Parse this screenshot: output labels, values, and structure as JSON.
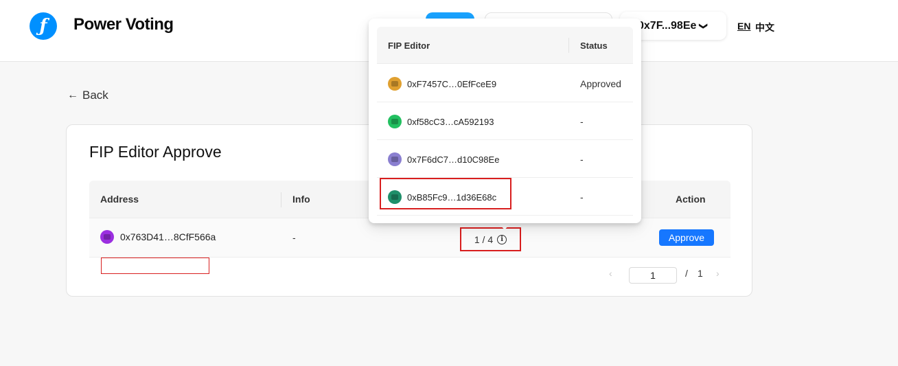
{
  "header": {
    "app_title": "Power Voting",
    "logo_glyph": "ƒ",
    "wallet_address": "0x7F...98Ee",
    "wallet_chevron": "❯",
    "lang_en": "EN",
    "lang_zh": "中文"
  },
  "nav": {
    "back_label": "Back",
    "back_icon": "←"
  },
  "card": {
    "title": "FIP Editor Approve",
    "columns": {
      "address": "Address",
      "info": "Info",
      "action": "Action"
    },
    "rows": [
      {
        "address": "0x763D41…8CfF566a",
        "info": "-",
        "ratio": "1 / 4",
        "action_label": "Approve",
        "avatar_color": "#9b2fe0"
      }
    ],
    "pagination": {
      "prev": "‹",
      "current": "1",
      "separator": "/",
      "total": "1",
      "next": "›"
    }
  },
  "popover": {
    "columns": {
      "editor": "FIP Editor",
      "status": "Status"
    },
    "rows": [
      {
        "address": "0xF7457C…0EfFceE9",
        "status": "Approved",
        "avatar_color": "#e0a030"
      },
      {
        "address": "0xf58cC3…cA592193",
        "status": "-",
        "avatar_color": "#22c060"
      },
      {
        "address": "0x7F6dC7…d10C98Ee",
        "status": "-",
        "avatar_color": "#8a7fd0"
      },
      {
        "address": "0xB85Fc9…1d36E68c",
        "status": "-",
        "avatar_color": "#1f8f6a"
      }
    ]
  },
  "colors": {
    "accent": "#1677ff",
    "highlight": "#d81e1e"
  },
  "icons": {
    "info": "i"
  }
}
